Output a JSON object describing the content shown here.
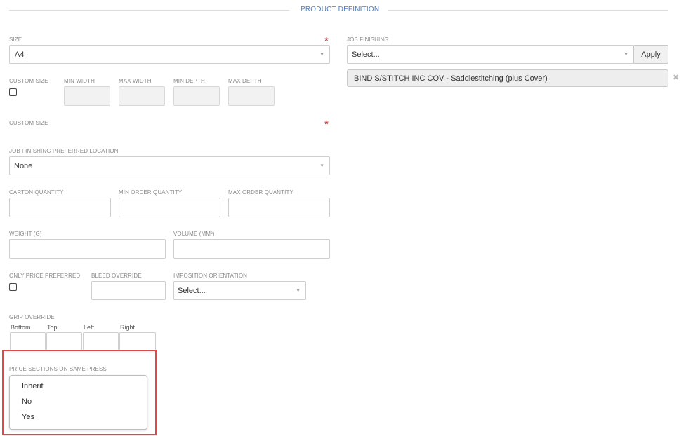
{
  "section": {
    "title": "PRODUCT DEFINITION"
  },
  "left": {
    "size": {
      "label": "SIZE",
      "value": "A4"
    },
    "custom_size_checkbox": {
      "label": "CUSTOM SIZE"
    },
    "min_width": {
      "label": "MIN WIDTH"
    },
    "max_width": {
      "label": "MAX WIDTH"
    },
    "min_depth": {
      "label": "MIN DEPTH"
    },
    "max_depth": {
      "label": "MAX DEPTH"
    },
    "custom_size": {
      "label": "CUSTOM SIZE"
    },
    "job_finishing_location": {
      "label": "JOB FINISHING PREFERRED LOCATION",
      "value": "None"
    },
    "carton_quantity": {
      "label": "CARTON QUANTITY"
    },
    "min_order_quantity": {
      "label": "MIN ORDER QUANTITY"
    },
    "max_order_quantity": {
      "label": "MAX ORDER QUANTITY"
    },
    "weight": {
      "label": "WEIGHT (G)"
    },
    "volume": {
      "label": "VOLUME (MM³)"
    },
    "only_price_preferred": {
      "label": "ONLY PRICE PREFERRED"
    },
    "bleed_override": {
      "label": "BLEED OVERRIDE"
    },
    "imposition_orientation": {
      "label": "IMPOSITION ORIENTATION",
      "value": "Select..."
    },
    "grip_override": {
      "label": "GRIP OVERRIDE",
      "fields": [
        "Bottom",
        "Top",
        "Left",
        "Right"
      ]
    },
    "price_sections": {
      "label": "PRICE SECTIONS ON SAME PRESS",
      "options": [
        "Inherit",
        "No",
        "Yes"
      ]
    }
  },
  "right": {
    "job_finishing": {
      "label": "JOB FINISHING",
      "placeholder": "Select...",
      "apply_label": "Apply",
      "items": [
        "BIND S/STITCH INC COV - Saddlestitching (plus Cover)"
      ],
      "remove_symbol": "✖"
    }
  },
  "required_symbol": "*",
  "caret_symbol": "▼",
  "colors": {
    "accent": "#4a7ec2",
    "required": "#b22b2b",
    "highlight": "#e04848"
  }
}
